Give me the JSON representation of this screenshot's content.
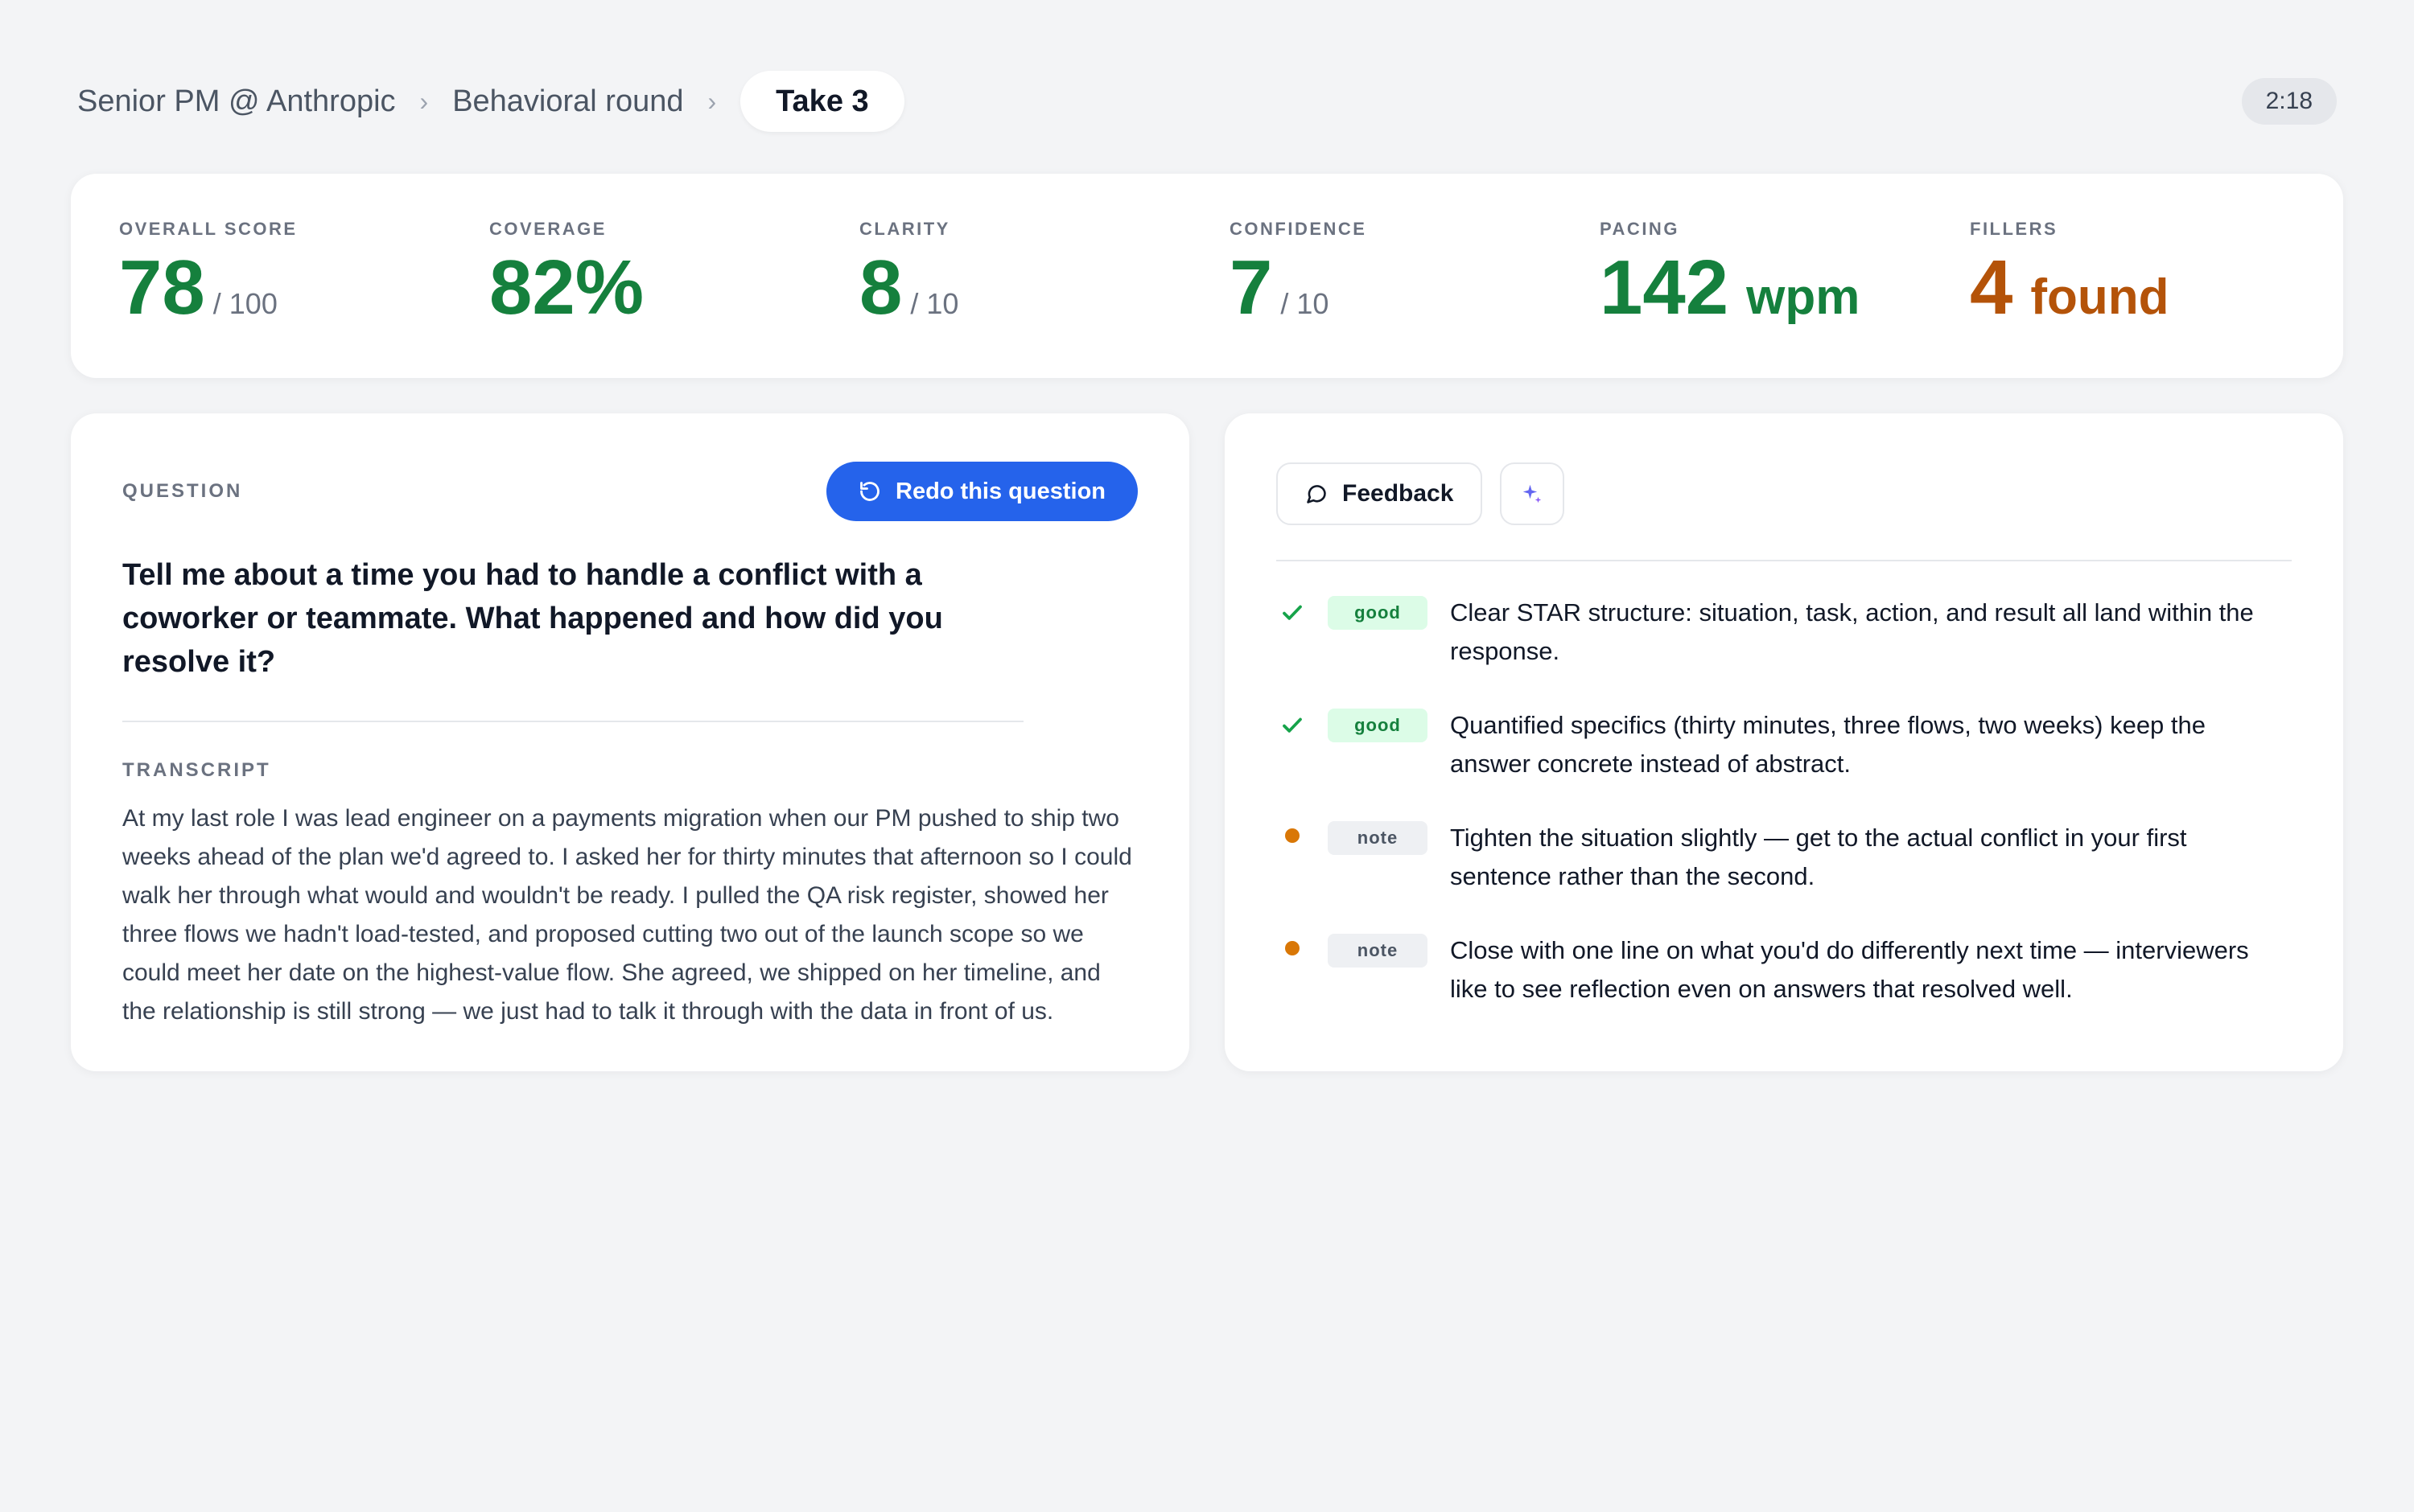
{
  "header": {
    "breadcrumb": [
      "Senior PM @ Anthropic",
      "Behavioral round"
    ],
    "current": "Take 3",
    "timer": "2:18"
  },
  "metrics": [
    {
      "label": "OVERALL SCORE",
      "value": "78",
      "suffix": "/ 100",
      "status": "good"
    },
    {
      "label": "COVERAGE",
      "value": "82%",
      "suffix": "",
      "status": "good"
    },
    {
      "label": "CLARITY",
      "value": "8",
      "suffix": "/ 10",
      "status": "good"
    },
    {
      "label": "CONFIDENCE",
      "value": "7",
      "suffix": "/ 10",
      "status": "good"
    },
    {
      "label": "PACING",
      "value": "142",
      "suffix": "wpm",
      "status": "good"
    },
    {
      "label": "FILLERS",
      "value": "4",
      "suffix": "found",
      "status": "warn"
    }
  ],
  "question": {
    "label": "QUESTION",
    "redo_label": "Redo this question",
    "text": "Tell me about a time you had to handle a conflict with a coworker or teammate. What happened and how did you resolve it?",
    "transcript_label": "TRANSCRIPT",
    "transcript": "At my last role I was lead engineer on a payments migration when our PM pushed to ship two weeks ahead of the plan we'd agreed to. I asked her for thirty minutes that afternoon so I could walk her through what would and wouldn't be ready. I pulled the QA risk register, showed her three flows we hadn't load-tested, and proposed cutting two out of the launch scope so we could meet her date on the highest-value flow. She agreed, we shipped on her timeline, and the relationship is still strong — we just had to talk it through with the data in front of us."
  },
  "feedback": {
    "tab_label": "Feedback",
    "items": [
      {
        "type": "good",
        "badge": "good",
        "text": "Clear STAR structure: situation, task, action, and result all land within the response."
      },
      {
        "type": "good",
        "badge": "good",
        "text": "Quantified specifics (thirty minutes, three flows, two weeks) keep the answer concrete instead of abstract."
      },
      {
        "type": "note",
        "badge": "note",
        "text": "Tighten the situation slightly — get to the actual conflict in your first sentence rather than the second."
      },
      {
        "type": "note",
        "badge": "note",
        "text": "Close with one line on what you'd do differently next time — interviewers like to see reflection even on answers that resolved well."
      }
    ]
  },
  "colors": {
    "accent": "#2563eb",
    "good": "#15803d",
    "warn": "#b45309",
    "note_dot": "#d97706",
    "background": "#f3f4f6"
  },
  "icons": {
    "redo": "refresh-icon",
    "feedback": "chat-bubble-icon",
    "sparkle": "sparkle-icon",
    "good": "check-icon",
    "note": "dot-icon"
  }
}
